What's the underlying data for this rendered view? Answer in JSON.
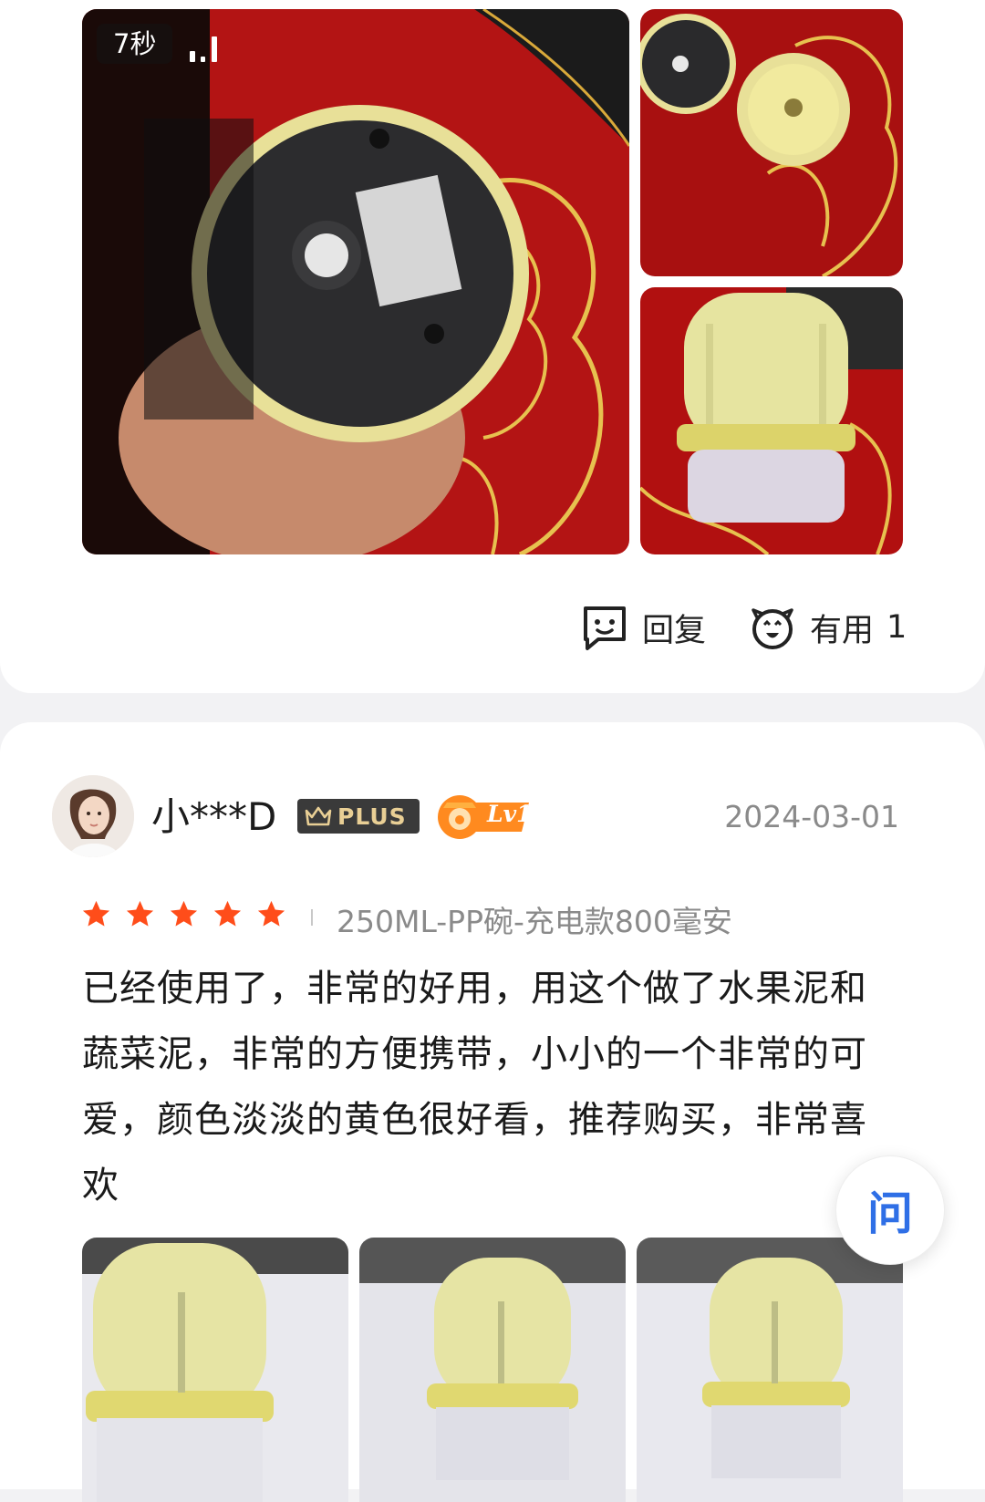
{
  "prev_review": {
    "video_duration": "7秒",
    "actions": {
      "reply_label": "回复",
      "useful_label": "有用",
      "useful_count": "1"
    }
  },
  "review": {
    "username": "小***D",
    "member_badge": "PLUS",
    "level_badge": "Lv1",
    "date": "2024-03-01",
    "rating": 5,
    "spec": "250ML-PP碗-充电款800毫安",
    "text": "已经使用了，非常的好用，用这个做了水果泥和蔬菜泥，非常的方便携带，小小的一个非常的可爱，颜色淡淡的黄色很好看，推荐购买，非常喜欢"
  },
  "floating_button": {
    "label": "问"
  },
  "colors": {
    "star": "#ff4d1a",
    "plus_badge_bg": "#3a3a3a",
    "plus_badge_text": "#e9cf95",
    "level_badge": "#ff8a1f",
    "ask_text": "#2f6fe6",
    "meta_gray": "#8a8a8a"
  }
}
